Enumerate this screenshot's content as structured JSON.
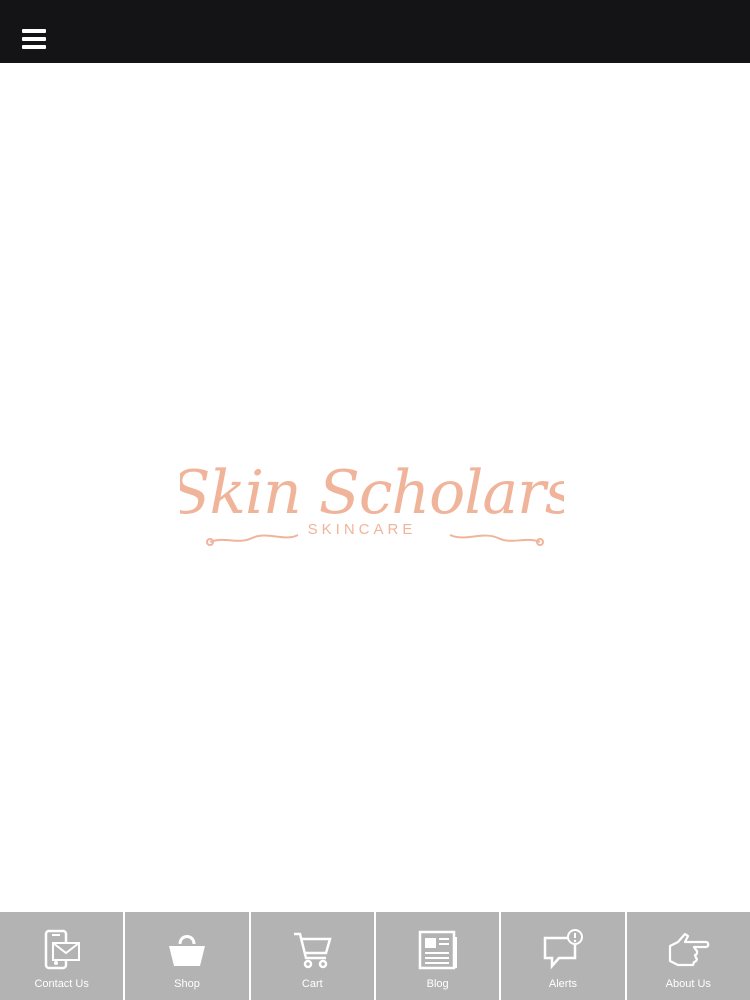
{
  "topbar": {
    "menu_icon": "hamburger-menu-icon",
    "background": "#141316"
  },
  "logo": {
    "title": "Skin Scholars",
    "subtitle": "SKINCARE",
    "color": "#f0b49a"
  },
  "tabbar": {
    "background": "#b3b3b3",
    "tabs": [
      {
        "label": "Contact Us",
        "icon": "contact-phone-envelope-icon"
      },
      {
        "label": "Shop",
        "icon": "shopping-bag-icon"
      },
      {
        "label": "Cart",
        "icon": "shopping-cart-icon"
      },
      {
        "label": "Blog",
        "icon": "newspaper-icon"
      },
      {
        "label": "Alerts",
        "icon": "alert-speech-bubble-icon"
      },
      {
        "label": "About Us",
        "icon": "pointing-hand-icon"
      }
    ]
  }
}
